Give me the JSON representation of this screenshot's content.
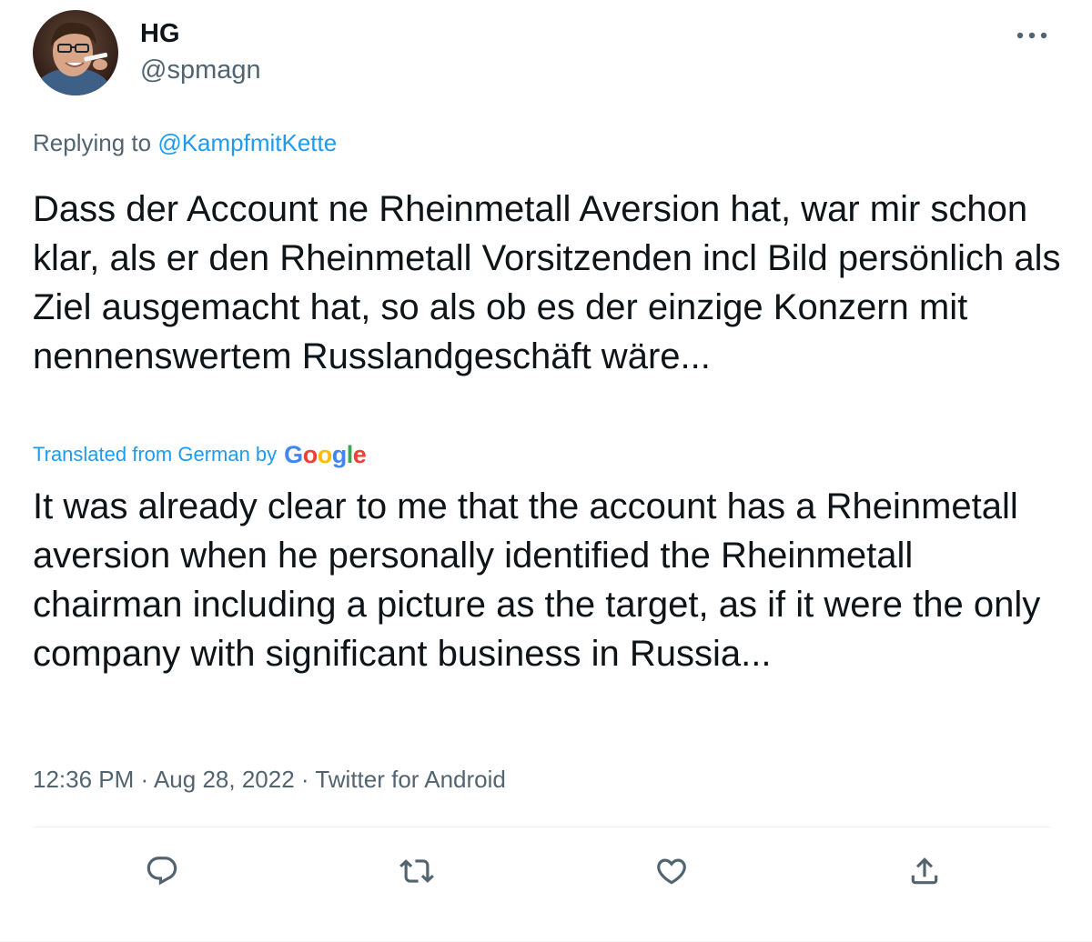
{
  "author": {
    "display_name": "HG",
    "handle": "@spmagn"
  },
  "replying_to": {
    "prefix": "Replying to ",
    "mention": "@KampfmitKette"
  },
  "tweet": {
    "original_text": "Dass der Account ne Rheinmetall Aversion hat, war mir schon klar, als er den Rheinmetall Vorsitzenden incl Bild persönlich als Ziel ausgemacht hat, so als ob es der einzige Konzern mit nennenswertem Russlandgeschäft wäre...",
    "translated_by_label": "Translated from German by",
    "translation_provider": {
      "letters": [
        "G",
        "o",
        "o",
        "g",
        "l",
        "e"
      ],
      "colors": [
        "#4285f4",
        "#ea4335",
        "#fbbc05",
        "#4285f4",
        "#34a853",
        "#ea4335"
      ]
    },
    "translated_text": "It was already clear to me that the account has a Rheinmetall aversion when he personally identified the Rheinmetall chairman including a picture as the target, as if it were the only company with significant business in Russia..."
  },
  "meta": {
    "time": "12:36 PM",
    "separator": " · ",
    "date": "Aug 28, 2022",
    "client": "Twitter for Android"
  },
  "actions": {
    "icons": [
      "reply-icon",
      "retweet-icon",
      "like-icon",
      "share-icon"
    ]
  },
  "colors": {
    "accent": "#1d9bf0",
    "secondary_text": "#536471",
    "primary_text": "#0f1419",
    "divider": "#eff3f4"
  }
}
